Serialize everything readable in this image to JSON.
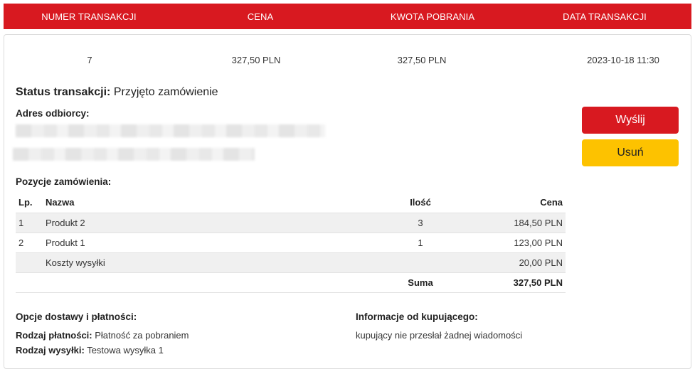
{
  "header": {
    "columns": [
      "NUMER TRANSAKCJI",
      "CENA",
      "KWOTA POBRANIA",
      "DATA TRANSAKCJI"
    ]
  },
  "transaction": {
    "number": "7",
    "price": "327,50 PLN",
    "cod_amount": "327,50 PLN",
    "date": "2023-10-18 11:30",
    "status_label": "Status transakcji:",
    "status_value": "Przyjęto zamówienie"
  },
  "address": {
    "title": "Adres odbiorcy:"
  },
  "actions": {
    "send_label": "Wyślij",
    "delete_label": "Usuń"
  },
  "order": {
    "title": "Pozycje zamówienia:",
    "columns": {
      "lp": "Lp.",
      "name": "Nazwa",
      "qty": "Ilość",
      "price": "Cena"
    },
    "rows": [
      {
        "lp": "1",
        "name": "Produkt 2",
        "qty": "3",
        "price": "184,50 PLN"
      },
      {
        "lp": "2",
        "name": "Produkt 1",
        "qty": "1",
        "price": "123,00 PLN"
      },
      {
        "lp": "",
        "name": "Koszty wysyłki",
        "qty": "",
        "price": "20,00 PLN"
      }
    ],
    "total_label": "Suma",
    "total_value": "327,50 PLN"
  },
  "delivery": {
    "title": "Opcje dostawy i płatności:",
    "payment_label": "Rodzaj płatności:",
    "payment_value": "Płatność za pobraniem",
    "shipping_label": "Rodzaj wysyłki:",
    "shipping_value": "Testowa wysyłka 1"
  },
  "buyer_info": {
    "title": "Informacje od kupującego:",
    "message": "kupujący nie przesłał żadnej wiadomości"
  },
  "colors": {
    "brand_red": "#d81920",
    "delete_yellow": "#fdc200"
  }
}
